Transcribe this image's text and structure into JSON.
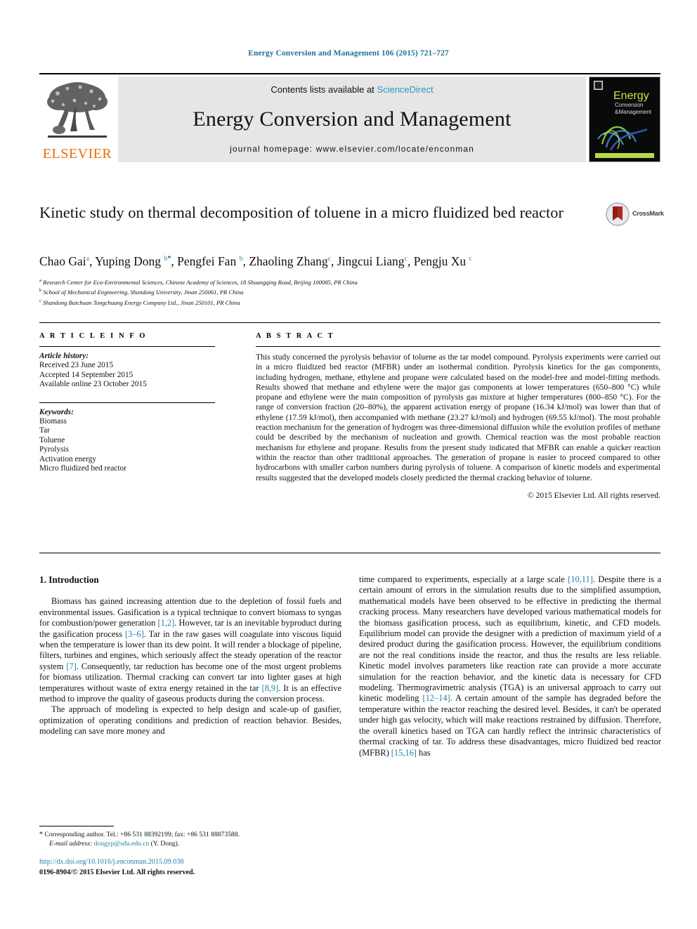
{
  "running_head": "Energy Conversion and Management 106 (2015) 721–727",
  "masthead": {
    "publisher_logo_label": "ELSEVIER",
    "contents_prefix": "Contents lists available at ",
    "contents_link": "ScienceDirect",
    "journal_name": "Energy Conversion and Management",
    "homepage_line": "journal homepage: www.elsevier.com/locate/enconman",
    "cover": {
      "line1": "Energy",
      "line2": "Conversion",
      "line3": "Management",
      "amp": "&"
    }
  },
  "article": {
    "title": "Kinetic study on thermal decomposition of toluene in a micro fluidized bed reactor",
    "crossmark_label": "CrossMark",
    "authors": [
      {
        "name": "Chao Gai",
        "sup": "a",
        "star": false
      },
      {
        "name": "Yuping Dong",
        "sup": "b",
        "star": true
      },
      {
        "name": "Pengfei Fan",
        "sup": "b",
        "star": false
      },
      {
        "name": "Zhaoling Zhang",
        "sup": "c",
        "star": false
      },
      {
        "name": "Jingcui Liang",
        "sup": "c",
        "star": false
      },
      {
        "name": "Pengju Xu",
        "sup": "c",
        "star": false
      }
    ],
    "affiliations": [
      {
        "marker": "a",
        "text": "Research Center for Eco-Environmental Sciences, Chinese Academy of Sciences, 18 Shuangqing Road, Beijing 100085, PR China"
      },
      {
        "marker": "b",
        "text": "School of Mechanical Engineering, Shandong University, Jinan 250061, PR China"
      },
      {
        "marker": "c",
        "text": "Shandong Baichuan Tongchuang Energy Company Ltd., Jinan 250101, PR China"
      }
    ]
  },
  "article_info": {
    "heading": "A R T I C L E    I N F O",
    "history_label": "Article history:",
    "history": [
      "Received 23 June 2015",
      "Accepted 14 September 2015",
      "Available online 23 October 2015"
    ],
    "keywords_label": "Keywords:",
    "keywords": [
      "Biomass",
      "Tar",
      "Toluene",
      "Pyrolysis",
      "Activation energy",
      "Micro fluidized bed reactor"
    ]
  },
  "abstract": {
    "heading": "A B S T R A C T",
    "text": "This study concerned the pyrolysis behavior of toluene as the tar model compound. Pyrolysis experiments were carried out in a micro fluidized bed reactor (MFBR) under an isothermal condition. Pyrolysis kinetics for the gas components, including hydrogen, methane, ethylene and propane were calculated based on the model-free and model-fitting methods. Results showed that methane and ethylene were the major gas components at lower temperatures (650–800 °C) while propane and ethylene were the main composition of pyrolysis gas mixture at higher temperatures (800–850 °C). For the range of conversion fraction (20–80%), the apparent activation energy of propane (16.34 kJ/mol) was lower than that of ethylene (17.59 kJ/mol), then accompanied with methane (23.27 kJ/mol) and hydrogen (69.55 kJ/mol). The most probable reaction mechanism for the generation of hydrogen was three-dimensional diffusion while the evolution profiles of methane could be described by the mechanism of nucleation and growth. Chemical reaction was the most probable reaction mechanism for ethylene and propane. Results from the present study indicated that MFBR can enable a quicker reaction within the reactor than other traditional approaches. The generation of propane is easier to proceed compared to other hydrocarbons with smaller carbon numbers during pyrolysis of toluene. A comparison of kinetic models and experimental results suggested that the developed models closely predicted the thermal cracking behavior of toluene.",
    "copyright": "© 2015 Elsevier Ltd. All rights reserved."
  },
  "body": {
    "section_heading": "1. Introduction",
    "left_paragraphs": [
      "Biomass has gained increasing attention due to the depletion of fossil fuels and environmental issues. Gasification is a typical technique to convert biomass to syngas for combustion/power generation [1,2]. However, tar is an inevitable byproduct during the gasification process [3–6]. Tar in the raw gases will coagulate into viscous liquid when the temperature is lower than its dew point. It will render a blockage of pipeline, filters, turbines and engines, which seriously affect the steady operation of the reactor system [7]. Consequently, tar reduction has become one of the most urgent problems for biomass utilization. Thermal cracking can convert tar into lighter gases at high temperatures without waste of extra energy retained in the tar [8,9]. It is an effective method to improve the quality of gaseous products during the conversion process.",
      "The approach of modeling is expected to help design and scale-up of gasifier, optimization of operating conditions and prediction of reaction behavior. Besides, modeling can save more money and"
    ],
    "right_paragraphs": [
      "time compared to experiments, especially at a large scale [10,11]. Despite there is a certain amount of errors in the simulation results due to the simplified assumption, mathematical models have been observed to be effective in predicting the thermal cracking process. Many researchers have developed various mathematical models for the biomass gasification process, such as equilibrium, kinetic, and CFD models. Equilibrium model can provide the designer with a prediction of maximum yield of a desired product during the gasification process. However, the equilibrium conditions are not the real conditions inside the reactor, and thus the results are less reliable. Kinetic model involves parameters like reaction rate can provide a more accurate simulation for the reaction behavior, and the kinetic data is necessary for CFD modeling. Thermogravimetric analysis (TGA) is an universal approach to carry out kinetic modeling [12–14]. A certain amount of the sample has degraded before the temperature within the reactor reaching the desired level. Besides, it can't be operated under high gas velocity, which will make reactions restrained by diffusion. Therefore, the overall kinetics based on TGA can hardly reflect the intrinsic characteristics of thermal cracking of tar. To address these disadvantages, micro fluidized bed reactor (MFBR) [15,16] has"
    ]
  },
  "footnote": {
    "star": "*",
    "corresponding": "Corresponding author. Tel.: +86 531 88392199; fax: +86 531 88873588.",
    "email_label": "E-mail address:",
    "email": "dongyp@sdu.edu.cn",
    "email_owner": "(Y. Dong)."
  },
  "footer": {
    "doi": "http://dx.doi.org/10.1016/j.enconman.2015.09.038",
    "issn": "0196-8904/© 2015 Elsevier Ltd. All rights reserved."
  },
  "colors": {
    "link": "#1f7fa8",
    "sciencedirect": "#2a93c9",
    "elsevier_orange": "#eb6e08",
    "band_gray": "#e6e6e6"
  }
}
